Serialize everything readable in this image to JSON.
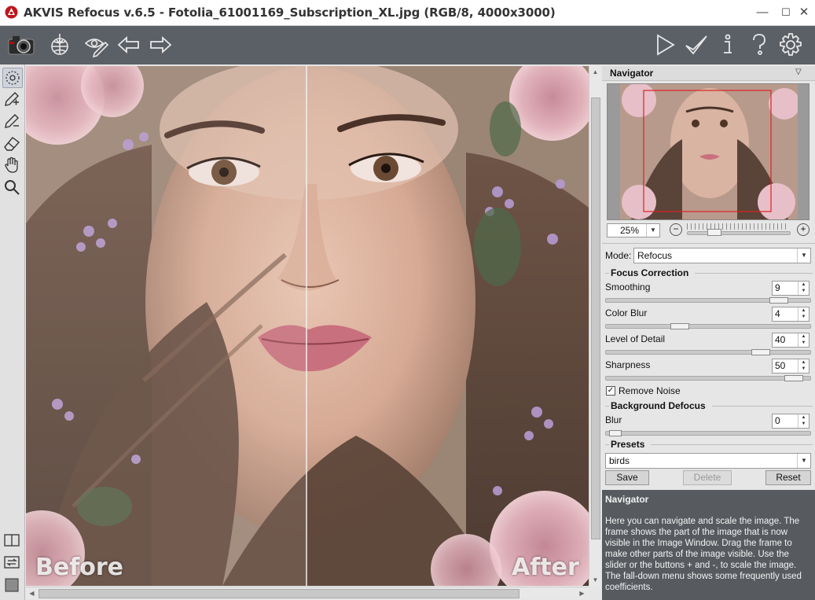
{
  "window": {
    "title": "AKVIS Refocus v.6.5 - Fotolia_61001169_Subscription_XL.jpg (RGB/8, 4000x3000)",
    "minimize": "—",
    "maximize": "☐",
    "close": "✕"
  },
  "toolbar": {
    "left_icons": [
      "camera-icon",
      "download-globe-icon",
      "eye-pen-icon",
      "arrow-left-icon",
      "arrow-right-icon"
    ],
    "right_icons": [
      "play-icon",
      "checkmark-icon",
      "info-icon",
      "help-icon",
      "settings-gear-icon"
    ]
  },
  "tools": {
    "top": [
      "focus-brush-tool-icon",
      "pencil-plus-icon",
      "pencil-minus-icon",
      "eraser-icon",
      "hand-icon",
      "zoom-icon"
    ],
    "bottom": [
      "split-view-icon",
      "swap-view-icon",
      "color-square-icon"
    ]
  },
  "canvas": {
    "before_label": "Before",
    "after_label": "After"
  },
  "navigator": {
    "title": "Navigator",
    "zoom": "25%",
    "minus": "−",
    "plus": "+"
  },
  "settings": {
    "mode_label": "Mode:",
    "mode_value": "Refocus",
    "focus_correction_title": "Focus Correction",
    "sliders": [
      {
        "label": "Smoothing",
        "value": "9",
        "fraction": 0.88
      },
      {
        "label": "Color Blur",
        "value": "4",
        "fraction": 0.35
      },
      {
        "label": "Level of Detail",
        "value": "40",
        "fraction": 0.78
      },
      {
        "label": "Sharpness",
        "value": "50",
        "fraction": 0.96
      }
    ],
    "remove_noise_label": "Remove Noise",
    "remove_noise_checked": true,
    "background_defocus_title": "Background Defocus",
    "blur_label": "Blur",
    "blur_value": "0",
    "blur_fraction": 0.02
  },
  "presets": {
    "title": "Presets",
    "value": "birds",
    "save": "Save",
    "delete": "Delete",
    "reset": "Reset"
  },
  "help": {
    "title": "Navigator",
    "text": "Here you can navigate and scale the image. The frame shows the part of the image that is now visible in the Image Window. Drag the frame to make other parts of the image visible. Use the slider or the buttons + and -, to scale the image. The fall-down menu shows some frequently used coefficients."
  }
}
